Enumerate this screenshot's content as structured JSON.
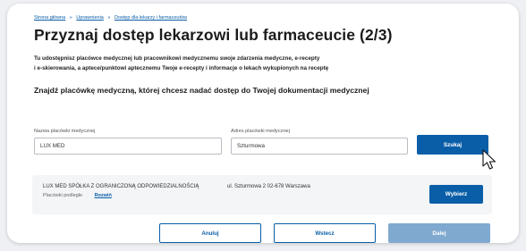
{
  "breadcrumb": {
    "items": [
      "Strona główna",
      "Uprawnienia",
      "Dostęp dla lekarzy i farmaceutów"
    ],
    "separator": "»"
  },
  "page": {
    "title": "Przyznaj dostęp lekarzowi lub farmaceucie (2/3)",
    "description_line1": "Tu udostępnisz placówce medycznej lub pracownikowi medycznemu swoje zdarzenia medyczne, e-recepty",
    "description_line2": "i e-skierowania, a aptece/punktowi aptecznemu Twoje e-recepty i informacje o lekach wykupionych na receptę",
    "section_title": "Znajdź placówkę medyczną, której chcesz nadać dostęp do Twojej dokumentacji medycznej"
  },
  "search": {
    "name_label": "Nazwa placówki medycznej",
    "name_value": "LUX MED",
    "address_label": "Adres placówki medycznej",
    "address_value": "Szturmowa",
    "search_label": "Szukaj"
  },
  "result": {
    "name": "LUX MED SPÓŁKA Z OGRANICZONĄ ODPOWIEDZIALNOŚCIĄ",
    "sub_label": "Placówki podległe",
    "expand_label": "Rozwiń",
    "address": "ul. Szturmowa 2 02-678 Warszawa",
    "choose_label": "Wybierz"
  },
  "footer": {
    "cancel_label": "Anuluj",
    "back_label": "Wstecz",
    "next_label": "Dalej"
  },
  "colors": {
    "accent": "#0a5ea8",
    "disabled_button": "#7fa9cf",
    "result_background": "#f3f5f7"
  },
  "icons": [
    "mouse-pointer-icon"
  ]
}
